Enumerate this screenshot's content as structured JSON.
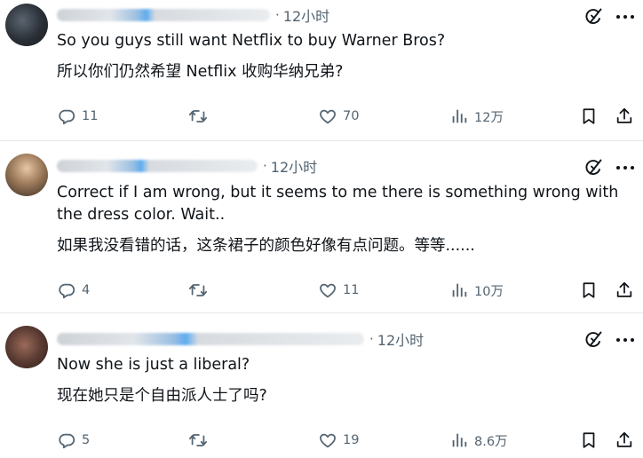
{
  "posts": [
    {
      "time": "12小时",
      "text_en": "So you guys still want Netflix to buy Warner Bros?",
      "text_zh": "所以你们仍然希望 Netflix 收购华纳兄弟?",
      "replies": "11",
      "likes": "70",
      "views": "12万"
    },
    {
      "time": "12小时",
      "text_en": "Correct if I am wrong, but it seems to me there is something wrong with the dress color. Wait..",
      "text_zh": "如果我没看错的话，这条裙子的颜色好像有点问题。等等......",
      "replies": "4",
      "likes": "11",
      "views": "10万"
    },
    {
      "time": "12小时",
      "text_en": "Now she is just a liberal?",
      "text_zh": "现在她只是个自由派人士了吗?",
      "replies": "5",
      "likes": "19",
      "views": "8.6万"
    }
  ],
  "sep": "·",
  "icons": [
    "reply-icon",
    "retweet-icon",
    "like-icon",
    "views-icon",
    "bookmark-icon",
    "share-icon",
    "grok-icon"
  ],
  "colors": {
    "text": "#0f1419",
    "secondary": "#536471",
    "divider": "#e6e9ec"
  }
}
